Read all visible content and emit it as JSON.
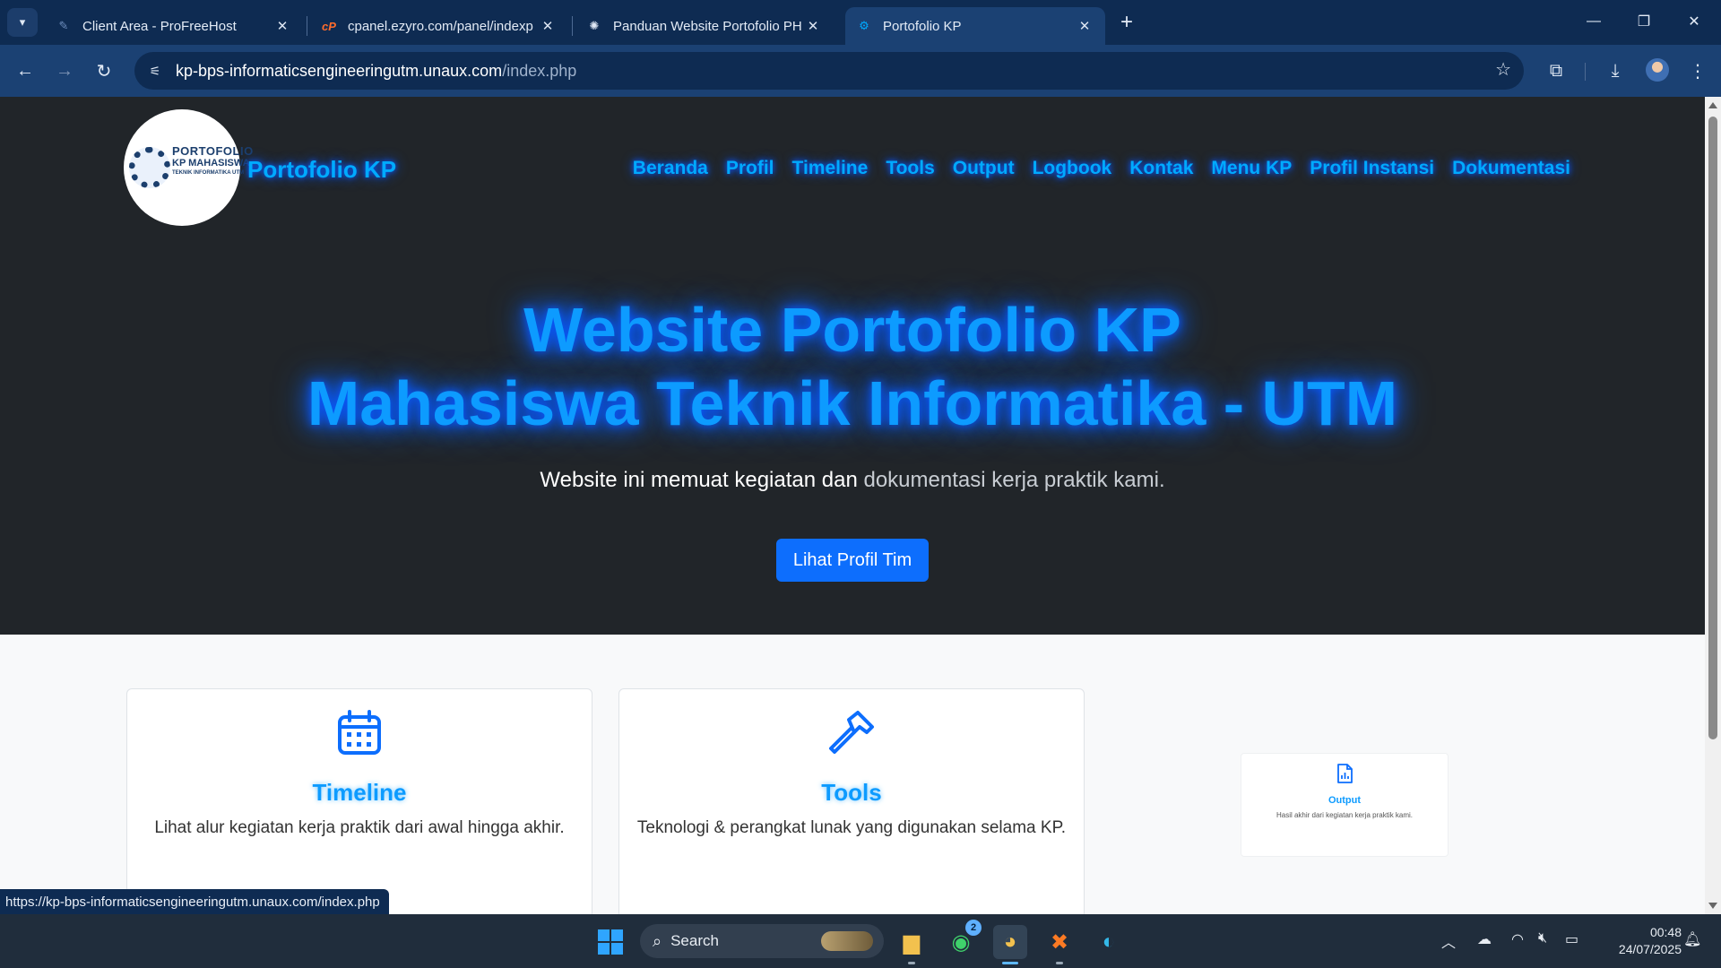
{
  "browser": {
    "tabs": [
      {
        "title": "Client Area - ProFreeHost",
        "icon": "feather-icon"
      },
      {
        "title": "cpanel.ezyro.com/panel/indexp",
        "icon": "cpanel-icon"
      },
      {
        "title": "Panduan Website Portofolio PH",
        "icon": "openai-icon"
      },
      {
        "title": "Portofolio KP",
        "icon": "page-favicon"
      }
    ],
    "active_tab_index": 3,
    "url_domain": "kp-bps-informaticsengineeringutm.unaux.com",
    "url_path": "/index.php",
    "status_url": "https://kp-bps-informaticsengineeringutm.unaux.com/index.php"
  },
  "site": {
    "logo": {
      "line1": "PORTOFOLIO",
      "line2": "KP MAHASISWA",
      "line3": "TEKNIK INFORMATIKA UTM"
    },
    "brand": "Portofolio KP",
    "nav": [
      "Beranda",
      "Profil",
      "Timeline",
      "Tools",
      "Output",
      "Logbook",
      "Kontak",
      "Menu KP",
      "Profil Instansi",
      "Dokumentasi"
    ],
    "hero": {
      "title_line1": "Website Portofolio KP",
      "title_line2": "Mahasiswa Teknik Informatika - UTM",
      "subtitle_a": "Website ini memuat kegiatan dan",
      "subtitle_b": " dokumentasi kerja praktik kami.",
      "button": "Lihat Profil Tim"
    },
    "cards": [
      {
        "title": "Timeline",
        "desc": "Lihat alur kegiatan kerja praktik dari awal hingga akhir.",
        "icon": "calendar-icon"
      },
      {
        "title": "Tools",
        "desc": "Teknologi & perangkat lunak yang digunakan selama KP.",
        "icon": "hammer-icon"
      },
      {
        "title": "Output",
        "desc": "Hasil akhir dari kegiatan kerja praktik kami.",
        "icon": "chart-file-icon"
      }
    ]
  },
  "taskbar": {
    "search_placeholder": "Search",
    "whatsapp_badge": "2",
    "time": "00:48",
    "date": "24/07/2025"
  },
  "colors": {
    "hero_bg": "#212529",
    "accent_glow": "#0d9bff",
    "primary_button": "#0d6efd",
    "browser_frame": "#0e2b52"
  }
}
